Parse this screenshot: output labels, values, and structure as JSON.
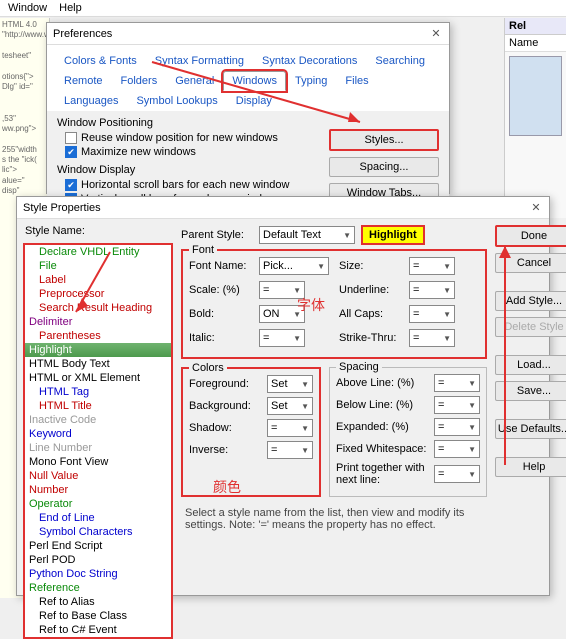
{
  "app": {
    "menu": [
      "Window",
      "Help"
    ],
    "code_fragment": "HTML 4.0\n\"http://www.w3.c\n\ntesheet\"\n\notions{\">\nDlg\" id=\"\n\n\n,53\"\nww.png\">\n\n255\"width\ns the \"ick(\nlic\">\nalue=\"\ndisp\"",
    "rel_panel": {
      "title": "Rel",
      "col": "Name"
    }
  },
  "prefs": {
    "title": "Preferences",
    "tabs_row1": [
      "Colors & Fonts",
      "Syntax Formatting",
      "Syntax Decorations",
      "Searching",
      "Remote",
      "Folders"
    ],
    "tabs_row2": [
      "General",
      "Windows",
      "Typing",
      "Files",
      "Languages",
      "Symbol Lookups",
      "Display"
    ],
    "selected_tab": "Windows",
    "grp1": "Window Positioning",
    "opt_reuse": "Reuse window position for new windows",
    "opt_max": "Maximize new windows",
    "grp2": "Window Display",
    "opt_hscroll": "Horizontal scroll bars for each new window",
    "opt_vscroll": "Vertical scroll bars for each new window",
    "btn_styles": "Styles...",
    "btn_spacing": "Spacing...",
    "btn_wtabs": "Window Tabs..."
  },
  "sp": {
    "title": "Style Properties",
    "lbl_stylename": "Style Name:",
    "lbl_parent": "Parent Style:",
    "parent_value": "Default Text",
    "highlight": "Highlight",
    "font_legend": "Font",
    "font_name_lbl": "Font Name:",
    "font_name_val": "Pick...",
    "size_lbl": "Size:",
    "scale_lbl": "Scale: (%)",
    "underline_lbl": "Underline:",
    "bold_lbl": "Bold:",
    "bold_val": "ON",
    "allcaps_lbl": "All Caps:",
    "italic_lbl": "Italic:",
    "strike_lbl": "Strike-Thru:",
    "colors_legend": "Colors",
    "fg_lbl": "Foreground:",
    "bg_lbl": "Background:",
    "shadow_lbl": "Shadow:",
    "inverse_lbl": "Inverse:",
    "set_val": "Set",
    "spacing_legend": "Spacing",
    "above_lbl": "Above Line: (%)",
    "below_lbl": "Below Line: (%)",
    "expanded_lbl": "Expanded: (%)",
    "fixedws_lbl": "Fixed Whitespace:",
    "printtog_lbl": "Print together with next line:",
    "eq": "=",
    "btn_done": "Done",
    "btn_cancel": "Cancel",
    "btn_add": "Add Style...",
    "btn_del": "Delete Style",
    "btn_load": "Load...",
    "btn_save": "Save...",
    "btn_defaults": "Use Defaults...",
    "btn_help": "Help",
    "note": "Select a style name from the list, then view and modify its settings. Note: '=' means the property has no effect.",
    "cn_font": "字体",
    "cn_color": "颜色",
    "styles": [
      {
        "t": "Declare VHDL Entity",
        "c": "c-green",
        "ind": 1
      },
      {
        "t": "File",
        "c": "c-green",
        "ind": 1
      },
      {
        "t": "Label",
        "c": "c-red",
        "ind": 1
      },
      {
        "t": "Preprocessor",
        "c": "c-red",
        "ind": 1
      },
      {
        "t": "Search Result Heading",
        "c": "c-red",
        "ind": 1
      },
      {
        "t": "Delimiter",
        "c": "c-purple",
        "ind": 0
      },
      {
        "t": "Parentheses",
        "c": "c-red",
        "ind": 1
      },
      {
        "t": "Highlight",
        "c": "",
        "ind": 0,
        "sel": true
      },
      {
        "t": "HTML Body Text",
        "c": "",
        "ind": 0
      },
      {
        "t": "HTML or XML Element",
        "c": "",
        "ind": 0
      },
      {
        "t": "HTML Tag",
        "c": "c-blue",
        "ind": 1
      },
      {
        "t": "HTML Title",
        "c": "c-red",
        "ind": 1
      },
      {
        "t": "Inactive Code",
        "c": "c-gray",
        "ind": 0
      },
      {
        "t": "Keyword",
        "c": "c-blue",
        "ind": 0
      },
      {
        "t": "Line Number",
        "c": "c-gray",
        "ind": 0
      },
      {
        "t": "Mono Font View",
        "c": "",
        "ind": 0
      },
      {
        "t": "Null Value",
        "c": "c-red",
        "ind": 0
      },
      {
        "t": "Number",
        "c": "c-red",
        "ind": 0
      },
      {
        "t": "Operator",
        "c": "c-green",
        "ind": 0
      },
      {
        "t": "End of Line",
        "c": "c-blue",
        "ind": 1
      },
      {
        "t": "Symbol Characters",
        "c": "c-blue",
        "ind": 1
      },
      {
        "t": "Perl End Script",
        "c": "",
        "ind": 0
      },
      {
        "t": "Perl POD",
        "c": "",
        "ind": 0
      },
      {
        "t": "Python Doc String",
        "c": "c-blue",
        "ind": 0
      },
      {
        "t": "Reference",
        "c": "c-green",
        "ind": 0
      },
      {
        "t": "Ref to Alias",
        "c": "",
        "ind": 1
      },
      {
        "t": "Ref to Base Class",
        "c": "",
        "ind": 1
      },
      {
        "t": "Ref to C# Event",
        "c": "",
        "ind": 1
      }
    ]
  }
}
